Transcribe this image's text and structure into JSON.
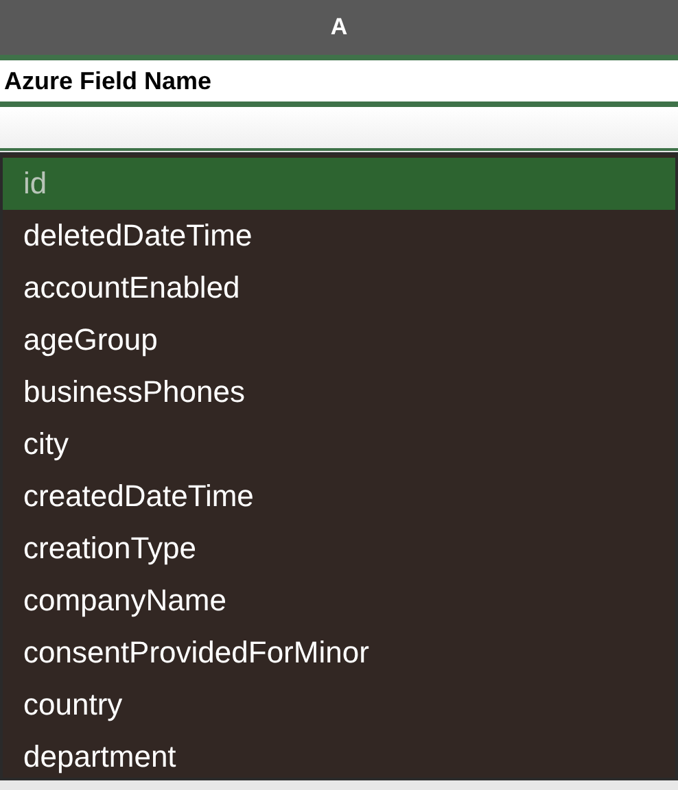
{
  "column_header": {
    "label": "A"
  },
  "cells": [
    "Azure Field Name",
    ""
  ],
  "dropdown": {
    "items": [
      {
        "label": "id",
        "selected": true
      },
      {
        "label": "deletedDateTime",
        "selected": false
      },
      {
        "label": "accountEnabled",
        "selected": false
      },
      {
        "label": "ageGroup",
        "selected": false
      },
      {
        "label": "businessPhones",
        "selected": false
      },
      {
        "label": "city",
        "selected": false
      },
      {
        "label": "createdDateTime",
        "selected": false
      },
      {
        "label": "creationType",
        "selected": false
      },
      {
        "label": "companyName",
        "selected": false
      },
      {
        "label": "consentProvidedForMinor",
        "selected": false
      },
      {
        "label": "country",
        "selected": false
      },
      {
        "label": "department",
        "selected": false
      }
    ]
  }
}
